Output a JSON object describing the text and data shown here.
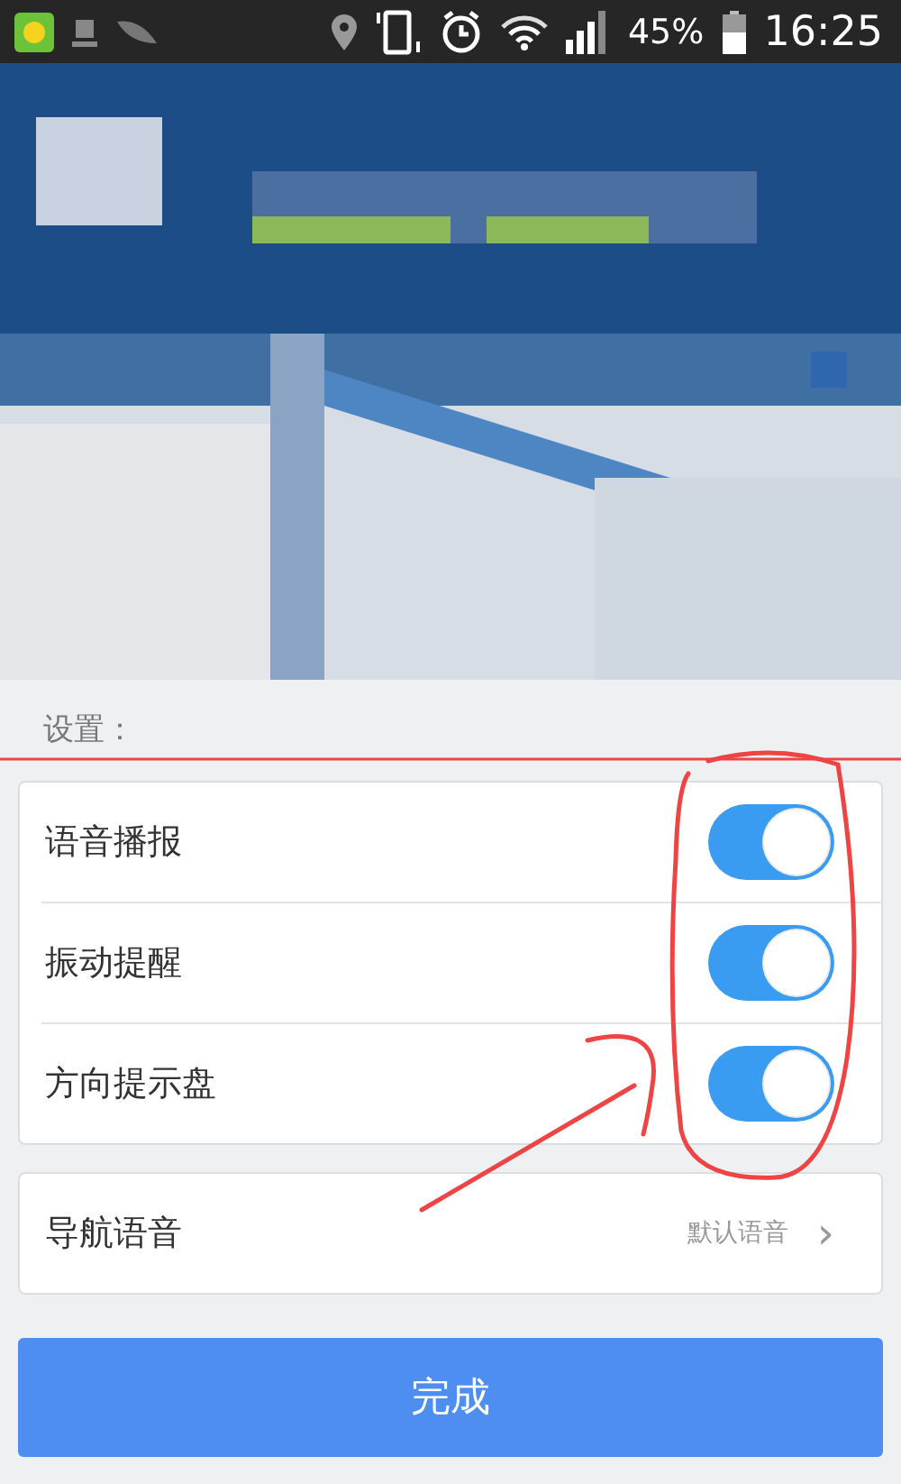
{
  "status_bar": {
    "battery": "45%",
    "time": "16:25"
  },
  "settings": {
    "title": "设置：",
    "toggles": [
      {
        "label": "语音播报",
        "on": true
      },
      {
        "label": "振动提醒",
        "on": true
      },
      {
        "label": "方向提示盘",
        "on": true
      }
    ],
    "nav_voice": {
      "label": "导航语音",
      "value": "默认语音",
      "chevron": "›"
    }
  },
  "done_button": "完成"
}
